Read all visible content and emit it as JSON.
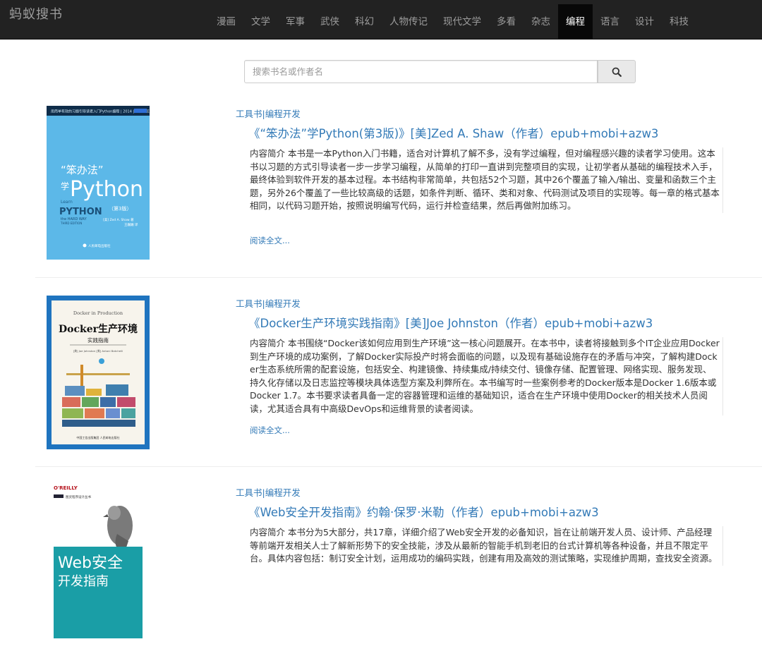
{
  "header": {
    "brand": "蚂蚁搜书",
    "nav": [
      {
        "label": "漫画"
      },
      {
        "label": "文学"
      },
      {
        "label": "军事"
      },
      {
        "label": "武侠"
      },
      {
        "label": "科幻"
      },
      {
        "label": "人物传记"
      },
      {
        "label": "现代文学"
      },
      {
        "label": "多看"
      },
      {
        "label": "杂志"
      },
      {
        "label": "编程",
        "active": true
      },
      {
        "label": "语言"
      },
      {
        "label": "设计"
      },
      {
        "label": "科技"
      }
    ]
  },
  "search": {
    "placeholder": "搜索书名或作者名",
    "value": "",
    "button_icon": "search-icon"
  },
  "books": [
    {
      "category": "工具书|编程开发",
      "title": "《“笨办法”学Python(第3版)》[美]Zed A. Shaw（作者）epub+mobi+azw3",
      "description": "内容简介 本书是一本Python入门书籍，适合对计算机了解不多，没有学过编程，但对编程感兴趣的读者学习使用。这本书以习题的方式引导读者一步一步学习编程，从简单的打印一直讲到完整项目的实现，让初学者从基础的编程技术入手，最终体验到软件开发的基本过程。本书结构非常简单，共包括52个习题，其中26个覆盖了输入/输出、变量和函数三个主题，另外26个覆盖了一些比较高级的话题，如条件判断、循环、类和对象、代码测试及项目的实现等。每一章的格式基本相同，以代码习题开始，按照说明编写代码，运行并检查结果，然后再做附加练习。",
      "more": "阅读全文...",
      "cover": {
        "top_line": "用简单有效的习题引导读者入门Python编程 | 2014 | 图灵社区",
        "title_cn_1": "“笨办法”",
        "title_cn_2": "学",
        "title_en": "Python",
        "edition": "（第3版）",
        "learn": "Learn",
        "python_big": "PYTHON",
        "hard_way": "the HARD WAY",
        "third": "THIRD EDITION",
        "author": "[美] Zed A. Shaw 著",
        "translator": "王巍巍 译",
        "publisher": "人民邮电出版社",
        "bg": "#5cb8e8"
      }
    },
    {
      "category": "工具书|编程开发",
      "title": "《Docker生产环境实践指南》[美]Joe Johnston（作者）epub+mobi+azw3",
      "description": "内容简介 本书围绕“Docker该如何应用到生产环境”这一核心问题展开。在本书中，读者将接触到多个IT企业应用Docker到生产环境的成功案例，了解Docker实际投产时将会面临的问题，以及现有基础设施存在的矛盾与冲突，了解构建Docker生态系统所需的配套设施，包括安全、构建镜像、持续集成/持续交付、镜像存储、配置管理、网络实现、服务发现、持久化存储以及日志监控等模块具体选型方案及利弊所在。本书编写时一些案例参考的Docker版本是Docker 1.6版本或Docker 1.7。本书要求读者具备一定的容器管理和运维的基础知识，适合在生产环境中使用Docker的相关技术人员阅读，尤其适合具有中高级DevOps和运维背景的读者阅读。",
      "more": "阅读全文...",
      "cover": {
        "top": "Docker in Production",
        "title_cn": "Docker生产环境",
        "subtitle": "实践指南",
        "authors": "[美] Joe Johnston  [美] Antoni Batchelli",
        "publisher": "中国工信出版集团  人民邮电出版社",
        "frame": "#1f74bf"
      }
    },
    {
      "category": "工具书|编程开发",
      "title": "《Web安全开发指南》约翰·保罗·米勒（作者）epub+mobi+azw3",
      "description": "内容简介 本书分为5大部分，共17章，详细介绍了Web安全开发的必备知识，旨在让前端开发人员、设计师、产品经理等前端开发相关人士了解新形势下的安全技能，涉及从最新的智能手机到老旧的台式计算机等各种设备，并且不限定平台。具体内容包括：制订安全计划，运用成功的编码实践，创建有用及高效的测试策略，实现维护周期，查找安全资源。",
      "more": "阅读全文...",
      "cover": {
        "brand": "O'REILLY",
        "series": "图灵程序设计丛书",
        "title_1": "Web安全",
        "title_2": "开发指南",
        "band": "#1a9ea6"
      }
    }
  ]
}
